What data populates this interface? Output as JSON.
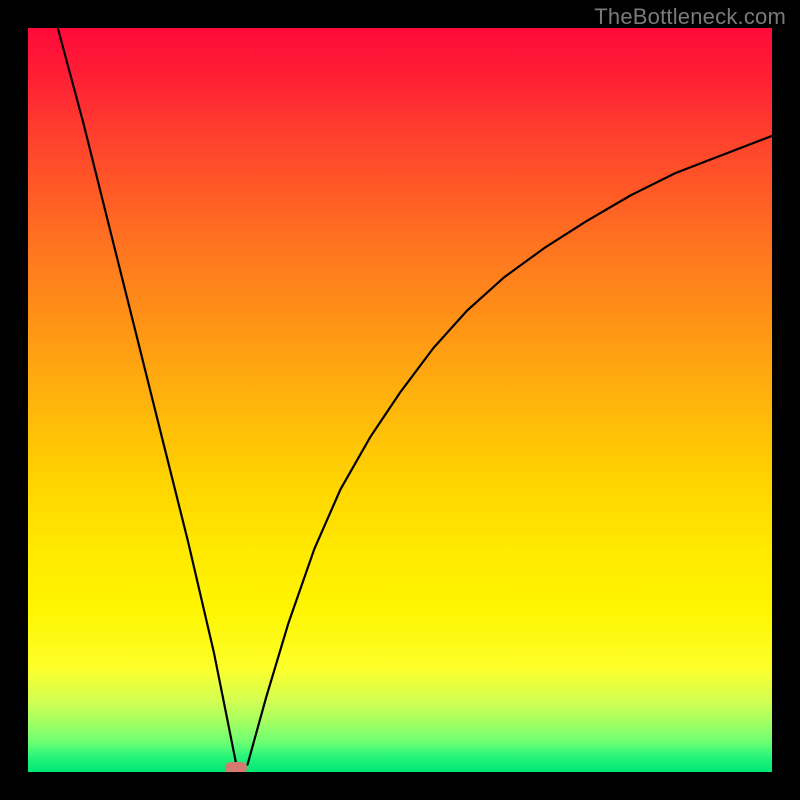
{
  "watermark": "TheBottleneck.com",
  "marker": {
    "x_frac": 0.28,
    "y_frac": 0.994
  },
  "chart_data": {
    "type": "line",
    "title": "",
    "xlabel": "",
    "ylabel": "",
    "xlim": [
      0,
      1
    ],
    "ylim": [
      0,
      1
    ],
    "grid": false,
    "legend": false,
    "annotations": [
      "TheBottleneck.com"
    ],
    "note": "Axes unlabeled; values are normalized fractions of plot area read from pixel positions. Background is a vertical red→yellow→green gradient. Curve is a V-shape: a near-straight descending left branch and a concave ascending right branch, meeting near the bottom at the marker.",
    "series": [
      {
        "name": "left-branch",
        "x": [
          0.04,
          0.075,
          0.11,
          0.145,
          0.18,
          0.215,
          0.25,
          0.268,
          0.28
        ],
        "y": [
          1.0,
          0.87,
          0.73,
          0.59,
          0.45,
          0.31,
          0.16,
          0.07,
          0.01
        ]
      },
      {
        "name": "right-branch",
        "x": [
          0.295,
          0.32,
          0.35,
          0.385,
          0.42,
          0.46,
          0.5,
          0.545,
          0.59,
          0.64,
          0.695,
          0.75,
          0.81,
          0.87,
          0.935,
          1.0
        ],
        "y": [
          0.01,
          0.1,
          0.2,
          0.3,
          0.38,
          0.45,
          0.51,
          0.57,
          0.62,
          0.665,
          0.705,
          0.74,
          0.775,
          0.805,
          0.83,
          0.855
        ]
      }
    ],
    "marker": {
      "shape": "rounded-rect",
      "color": "#d47a6f",
      "x": 0.28,
      "y": 0.006
    }
  }
}
